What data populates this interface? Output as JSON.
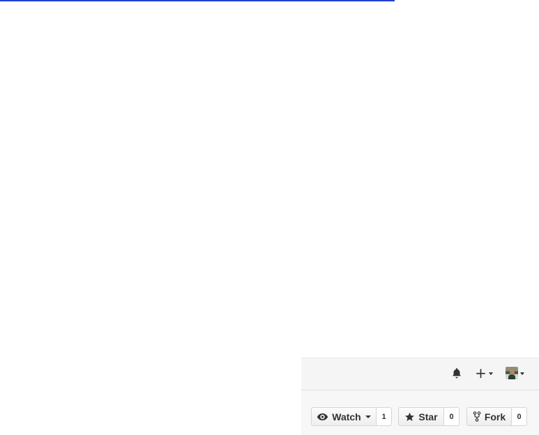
{
  "page": {
    "background": "#ffffff",
    "link_color": "#1e3fd1"
  },
  "header": {
    "notifications_icon": "bell-icon",
    "new_menu_icon": "plus-icon",
    "user_menu_icon": "avatar-icon"
  },
  "repo_actions": {
    "watch": {
      "icon": "eye-icon",
      "label": "Watch",
      "count": "1"
    },
    "star": {
      "icon": "star-icon",
      "label": "Star",
      "count": "0"
    },
    "fork": {
      "icon": "fork-icon",
      "label": "Fork",
      "count": "0"
    }
  }
}
